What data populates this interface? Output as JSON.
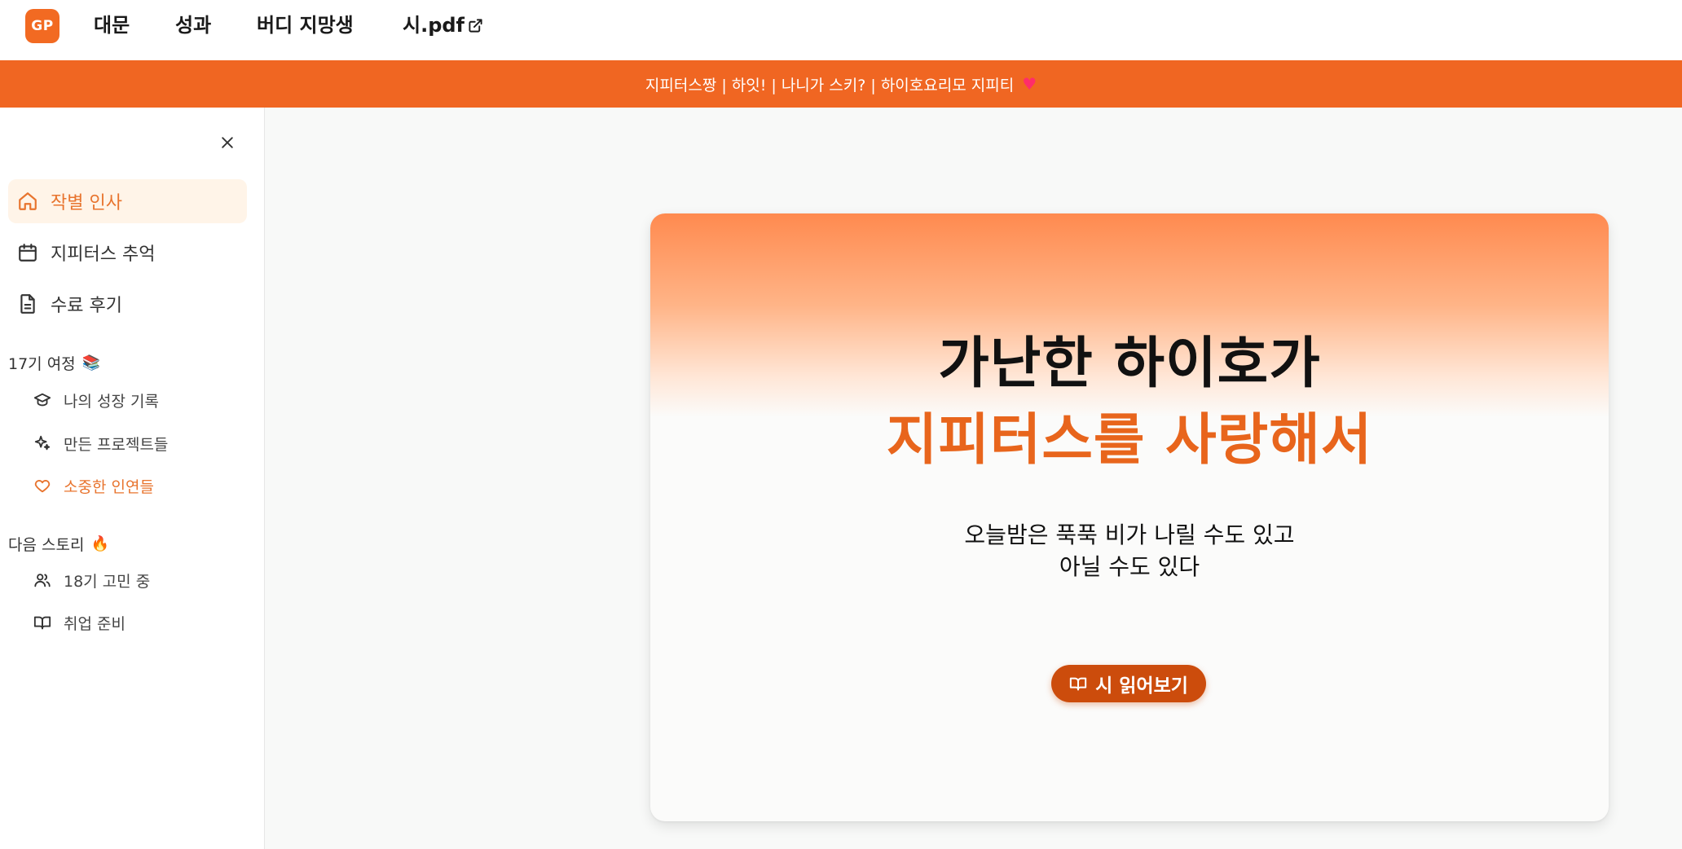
{
  "nav": {
    "logo": "GP",
    "links": [
      "대문",
      "성과",
      "버디 지망생",
      "시.pdf"
    ]
  },
  "banner": {
    "text": "지피터스짱 | 하잇! | 나니가 스키? | 하이호요리모 지피티",
    "heart": "♥"
  },
  "sidebar": {
    "items": [
      {
        "label": "작별 인사",
        "icon": "home-icon",
        "active": true
      },
      {
        "label": "지피터스 추억",
        "icon": "calendar-icon",
        "active": false
      },
      {
        "label": "수료 후기",
        "icon": "document-icon",
        "active": false
      }
    ],
    "sections": [
      {
        "title": "17기 여정",
        "emoji": "📚",
        "items": [
          {
            "label": "나의 성장 기록",
            "icon": "graduation-cap-icon",
            "active": false
          },
          {
            "label": "만든 프로젝트들",
            "icon": "sparkles-icon",
            "active": false
          },
          {
            "label": "소중한 인연들",
            "icon": "heart-icon",
            "active": true
          }
        ]
      },
      {
        "title": "다음 스토리",
        "emoji": "🔥",
        "items": [
          {
            "label": "18기 고민 중",
            "icon": "users-icon",
            "active": false
          },
          {
            "label": "취업 준비",
            "icon": "book-icon",
            "active": false
          }
        ]
      }
    ]
  },
  "hero": {
    "title_line1": "가난한 하이호가",
    "title_line2": "지피터스를 사랑해서",
    "body_line1": "오늘밤은 푹푹 비가 나릴 수도 있고",
    "body_line2": "아닐 수도 있다",
    "button_label": "시 읽어보기"
  },
  "colors": {
    "accent": "#f06622",
    "accent_dark": "#cc4c0c",
    "active_bg": "#fff4e8"
  }
}
